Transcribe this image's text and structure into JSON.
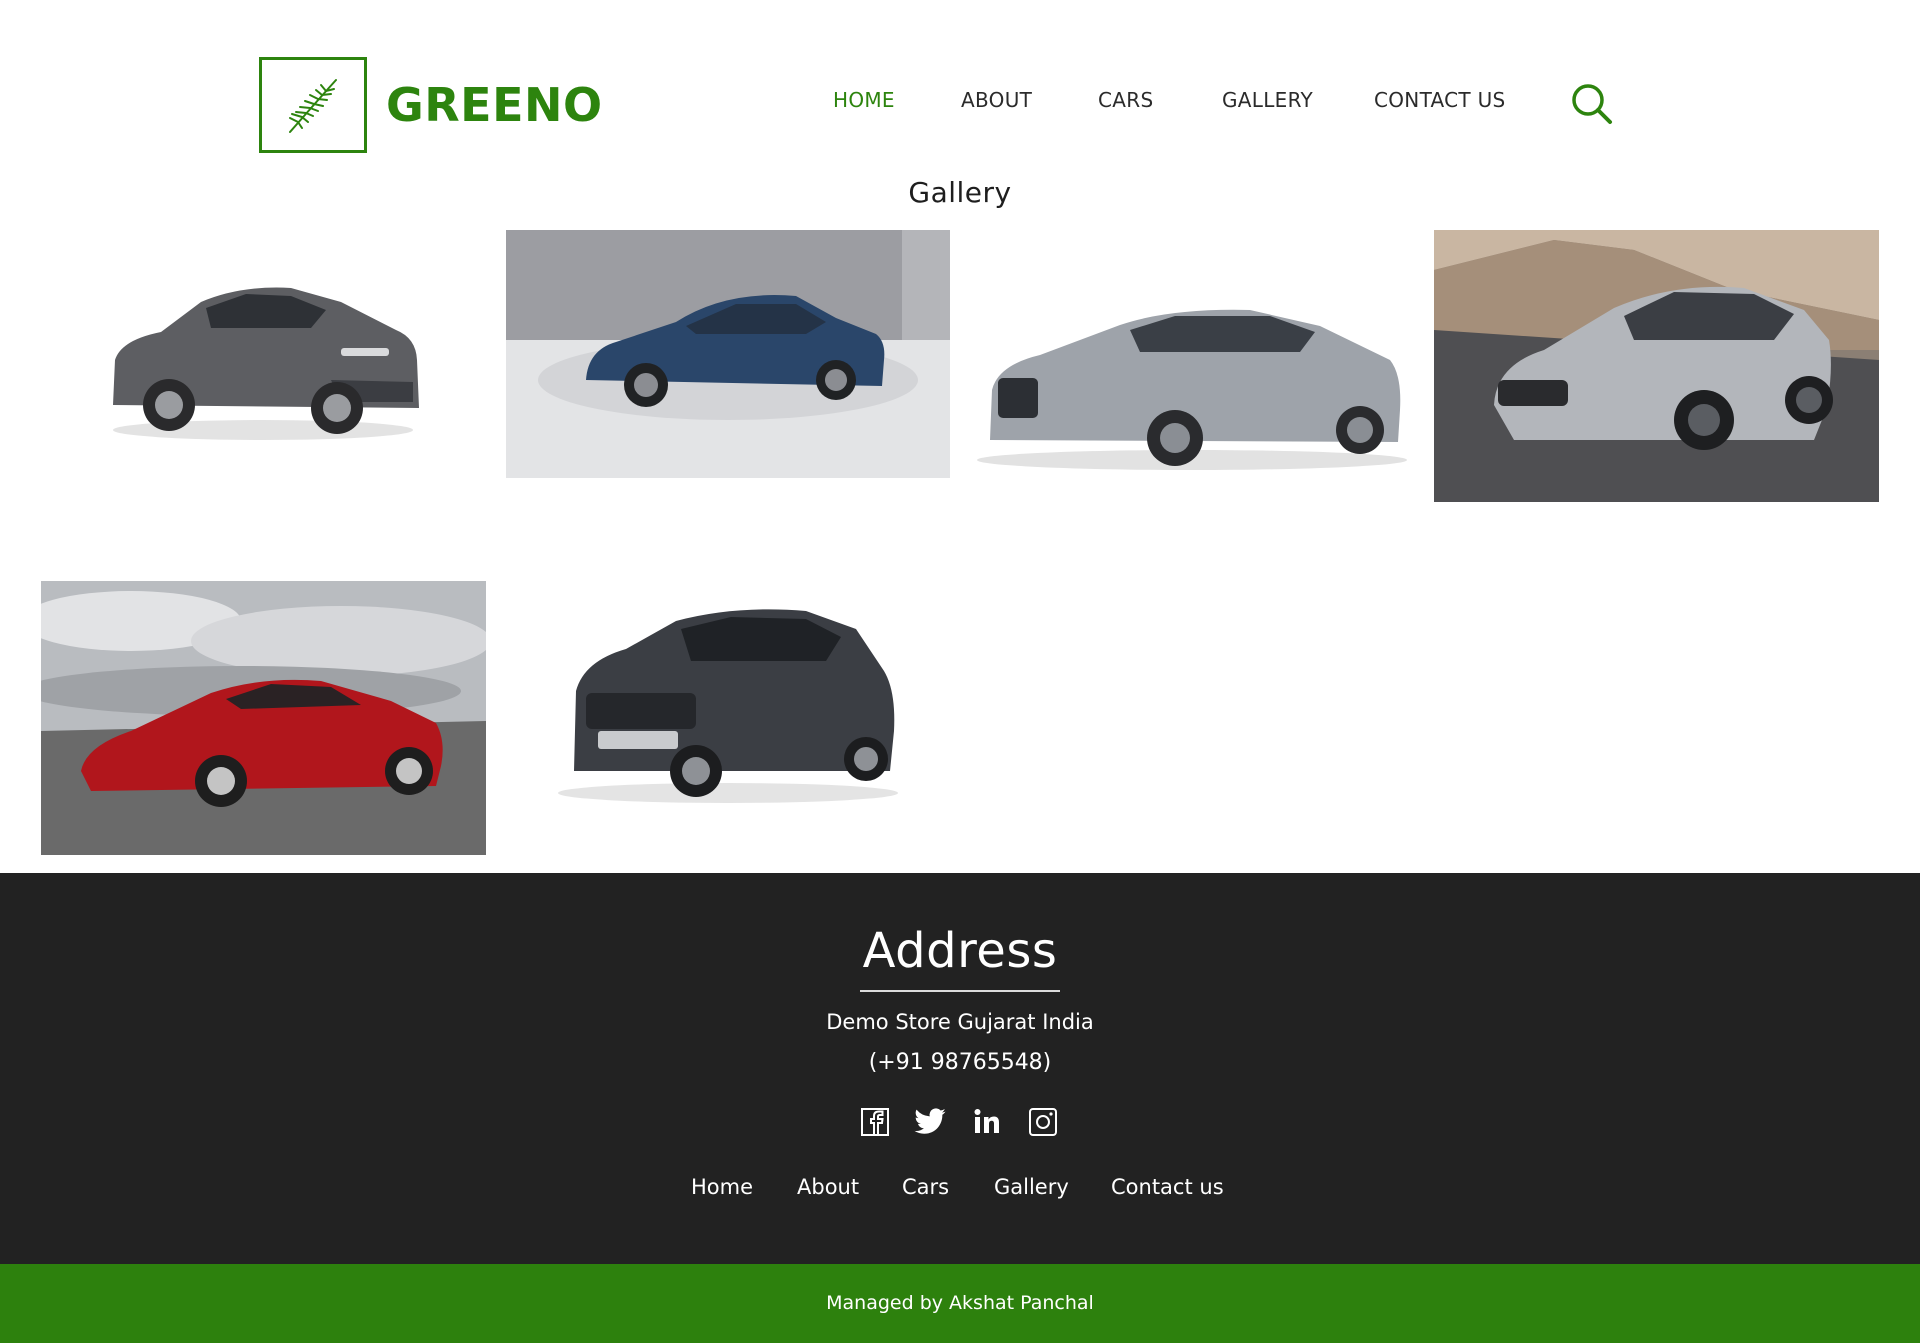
{
  "brand": {
    "name": "GREENO",
    "logo_icon": "palm-leaf-icon",
    "accent": "#2d840e"
  },
  "nav": {
    "items": [
      {
        "label": "HOME",
        "active": true
      },
      {
        "label": "ABOUT",
        "active": false
      },
      {
        "label": "CARS",
        "active": false
      },
      {
        "label": "GALLERY",
        "active": false
      },
      {
        "label": "CONTACT US",
        "active": false
      }
    ],
    "search_icon": "search-icon"
  },
  "gallery": {
    "title": "Gallery",
    "images": [
      {
        "subject": "grey sedan",
        "background": "white"
      },
      {
        "subject": "blue coupe",
        "background": "grey studio"
      },
      {
        "subject": "silver sedan",
        "background": "white"
      },
      {
        "subject": "silver muscle car",
        "background": "coastal road"
      },
      {
        "subject": "red sports car",
        "background": "cloudy sky"
      },
      {
        "subject": "dark grey compact SUV",
        "background": "white"
      }
    ]
  },
  "footer": {
    "heading": "Address",
    "address": "Demo Store Gujarat India",
    "phone": "(+91 98765548)",
    "social_icons": [
      "facebook-icon",
      "twitter-icon",
      "linkedin-icon",
      "instagram-icon"
    ],
    "links": [
      "Home",
      "About",
      "Cars",
      "Gallery",
      "Contact us"
    ],
    "background": "#222222"
  },
  "bottom_bar": {
    "text": "Managed by Akshat Panchal",
    "background": "#2d810d"
  }
}
